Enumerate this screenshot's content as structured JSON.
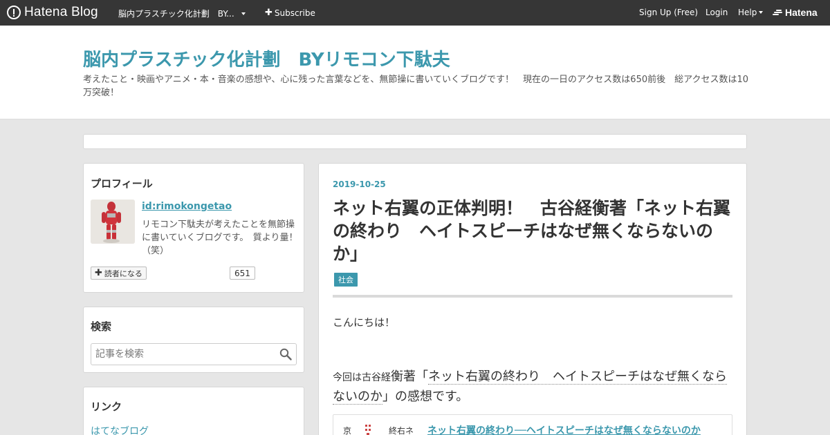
{
  "topbar": {
    "logo": "Hatena Blog",
    "blog_selector": "脳内プラスチック化計劃　BY...",
    "subscribe": "Subscribe",
    "sign_up": "Sign Up (Free)",
    "login": "Login",
    "help": "Help",
    "hatena": "Hatena"
  },
  "header": {
    "title": "脳内プラスチック化計劃　BYリモコン下駄夫",
    "description": "考えたこと・映画やアニメ・本・音楽の感想や、心に残った言葉などを、無節操に書いていくブログです！　現在の一日のアクセス数は650前後　総アクセス数は10万突破！"
  },
  "profile": {
    "heading": "プロフィール",
    "user_id": "id:rimokongetao",
    "description": "リモコン下駄夫が考えたことを無節操に書いていくブログです。　質より量！（笑）",
    "subscribe_label": "読者になる",
    "subscriber_count": "651"
  },
  "search": {
    "heading": "検索",
    "placeholder": "記事を検索"
  },
  "links": {
    "heading": "リンク",
    "items": [
      "はてなブログ"
    ]
  },
  "entry": {
    "date": "2019-10-25",
    "title": "ネット右翼の正体判明！　古谷経衡著「ネット右翼の終わり　ヘイトスピーチはなぜ無くならないのか」",
    "category": "社会",
    "greeting": "こんにちは！",
    "p2_lead": "今回は古谷経",
    "p2_mid": "衡著「",
    "p2_underlined": "ネット右翼の終わり　ヘイトスピーチはなぜ無くならないのか",
    "p2_tail": "」の感想です。",
    "embed_label1": "京",
    "embed_label2": "終右ネ",
    "embed_title": "ネット右翼の終わり──ヘイトスピーチはなぜ無くならないのか"
  },
  "colors": {
    "topbar_bg": "#363636",
    "accent": "#3c98ad",
    "page_bg": "#e6e6e6"
  }
}
